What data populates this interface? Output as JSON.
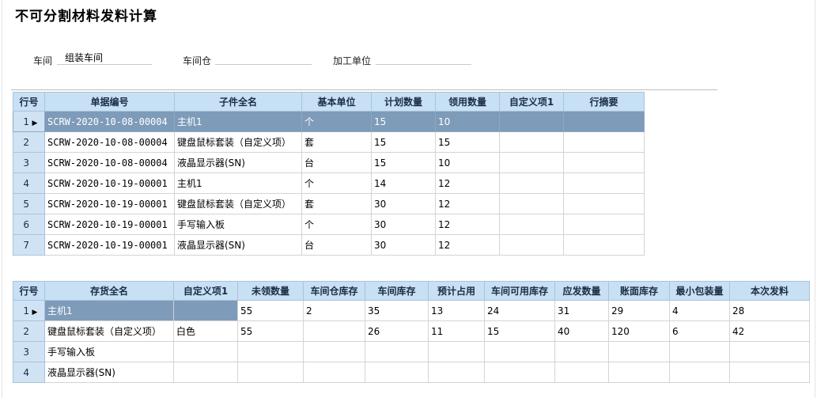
{
  "title": "不可分割材料发料计算",
  "form": {
    "workshop_label": "车间",
    "workshop_value": "组装车间",
    "warehouse_label": "车间仓",
    "warehouse_value": "",
    "unit_label": "加工单位",
    "unit_value": ""
  },
  "grid1": {
    "headers": [
      "行号",
      "单据编号",
      "子件全名",
      "基本单位",
      "计划数量",
      "领用数量",
      "自定义项1",
      "行摘要"
    ],
    "rows": [
      {
        "no": "1",
        "doc": "SCRW-2020-10-08-00004",
        "name": "主机1",
        "unit": "个",
        "plan": "15",
        "used": "10",
        "custom": "",
        "summary": ""
      },
      {
        "no": "2",
        "doc": "SCRW-2020-10-08-00004",
        "name": "键盘鼠标套装（自定义项）",
        "unit": "套",
        "plan": "15",
        "used": "15",
        "custom": "",
        "summary": ""
      },
      {
        "no": "3",
        "doc": "SCRW-2020-10-08-00004",
        "name": "液晶显示器(SN)",
        "unit": "台",
        "plan": "15",
        "used": "10",
        "custom": "",
        "summary": ""
      },
      {
        "no": "4",
        "doc": "SCRW-2020-10-19-00001",
        "name": "主机1",
        "unit": "个",
        "plan": "14",
        "used": "12",
        "custom": "",
        "summary": ""
      },
      {
        "no": "5",
        "doc": "SCRW-2020-10-19-00001",
        "name": "键盘鼠标套装（自定义项）",
        "unit": "套",
        "plan": "30",
        "used": "12",
        "custom": "",
        "summary": ""
      },
      {
        "no": "6",
        "doc": "SCRW-2020-10-19-00001",
        "name": "手写输入板",
        "unit": "个",
        "plan": "30",
        "used": "12",
        "custom": "",
        "summary": ""
      },
      {
        "no": "7",
        "doc": "SCRW-2020-10-19-00001",
        "name": "液晶显示器(SN)",
        "unit": "台",
        "plan": "30",
        "used": "12",
        "custom": "",
        "summary": ""
      }
    ]
  },
  "grid2": {
    "headers": [
      "行号",
      "存货全名",
      "自定义项1",
      "未领数量",
      "车间仓库存",
      "车间库存",
      "预计占用",
      "车间可用库存",
      "应发数量",
      "账面库存",
      "最小包装量",
      "本次发料"
    ],
    "rows": [
      {
        "no": "1",
        "name": "主机1",
        "custom": "",
        "unissued": "55",
        "wh_stock": "2",
        "ws_stock": "35",
        "reserved": "13",
        "available": "24",
        "to_issue": "31",
        "book": "29",
        "min_pack": "4",
        "issue_now": "28"
      },
      {
        "no": "2",
        "name": "键盘鼠标套装（自定义项）",
        "custom": "白色",
        "unissued": "55",
        "wh_stock": "",
        "ws_stock": "26",
        "reserved": "11",
        "available": "15",
        "to_issue": "40",
        "book": "120",
        "min_pack": "6",
        "issue_now": "42"
      },
      {
        "no": "3",
        "name": "手写输入板",
        "custom": "",
        "unissued": "",
        "wh_stock": "",
        "ws_stock": "",
        "reserved": "",
        "available": "",
        "to_issue": "",
        "book": "",
        "min_pack": "",
        "issue_now": ""
      },
      {
        "no": "4",
        "name": "液晶显示器(SN)",
        "custom": "",
        "unissued": "",
        "wh_stock": "",
        "ws_stock": "",
        "reserved": "",
        "available": "",
        "to_issue": "",
        "book": "",
        "min_pack": "",
        "issue_now": ""
      }
    ]
  },
  "colors": {
    "header_bg": "#c8e0f4",
    "selected_bg": "#7e9bb9"
  },
  "icons": {
    "row_pointer": "current-row-pointer-icon"
  }
}
